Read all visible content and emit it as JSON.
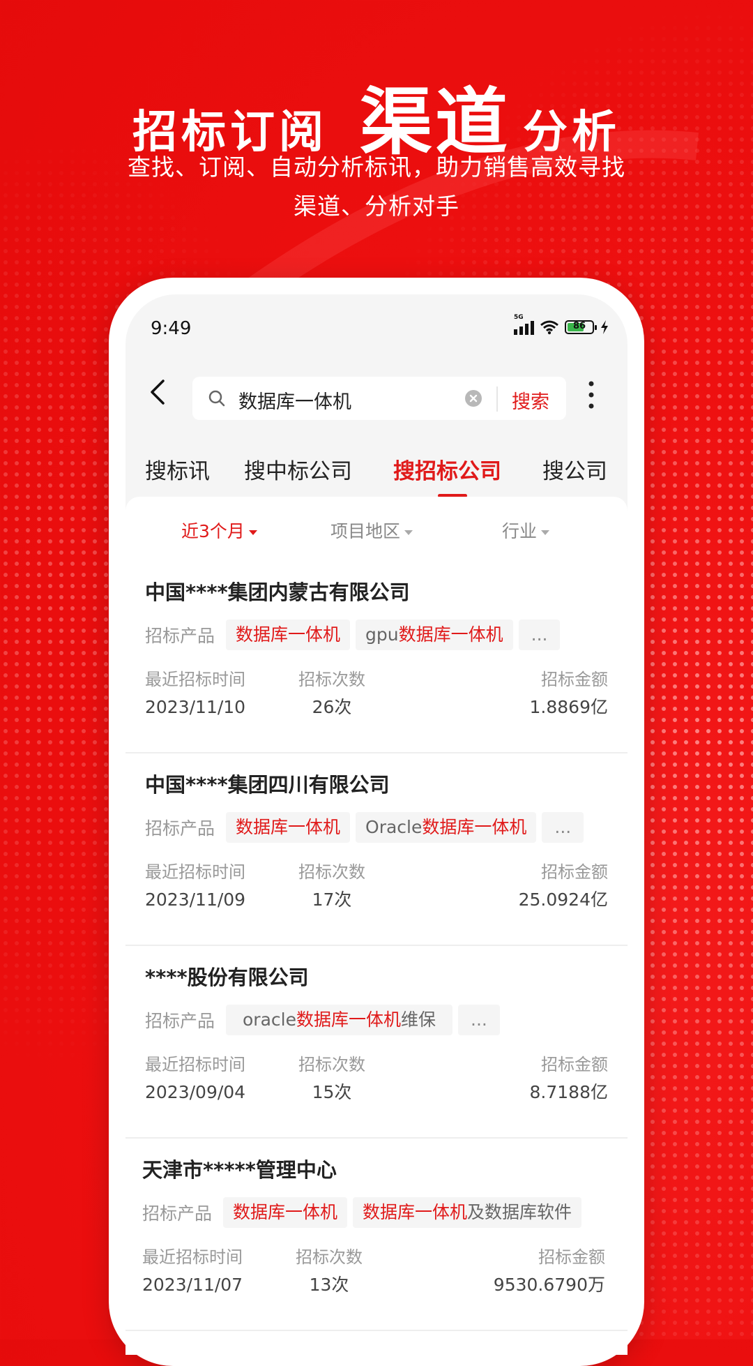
{
  "promo": {
    "title_part1": "招标订阅",
    "title_part2": "渠道",
    "title_part3": "分析",
    "subtitle_line1": "查找、订阅、自动分析标讯，助力销售高效寻找",
    "subtitle_line2": "渠道、分析对手"
  },
  "status_bar": {
    "time": "9:49",
    "network": "5G",
    "battery": "86"
  },
  "search": {
    "query": "数据库一体机",
    "button": "搜索"
  },
  "tabs": [
    {
      "label": "搜标讯",
      "active": false
    },
    {
      "label": "搜中标公司",
      "active": false
    },
    {
      "label": "搜招标公司",
      "active": true
    },
    {
      "label": "搜公司",
      "active": false
    }
  ],
  "filters": [
    {
      "label": "近3个月",
      "active": true
    },
    {
      "label": "项目地区",
      "active": false
    },
    {
      "label": "行业",
      "active": false
    }
  ],
  "labels": {
    "products": "招标产品",
    "last_time": "最近招标时间",
    "count": "招标次数",
    "amount": "招标金额"
  },
  "results": [
    {
      "company": "中国****集团内蒙古有限公司",
      "tags": [
        {
          "pre": "",
          "hl": "数据库一体机",
          "post": ""
        },
        {
          "pre": "gpu",
          "hl": "数据库一体机",
          "post": ""
        }
      ],
      "more": "...",
      "last_time": "2023/11/10",
      "count": "26次",
      "amount": "1.8869亿"
    },
    {
      "company": "中国****集团四川有限公司",
      "tags": [
        {
          "pre": "",
          "hl": "数据库一体机",
          "post": ""
        },
        {
          "pre": "Oracle",
          "hl": "数据库一体机",
          "post": ""
        }
      ],
      "more": "...",
      "last_time": "2023/11/09",
      "count": "17次",
      "amount": "25.0924亿"
    },
    {
      "company": "****股份有限公司",
      "tags": [
        {
          "pre": "oracle",
          "hl": "数据库一体机",
          "post": "维保"
        }
      ],
      "more": "...",
      "last_time": "2023/09/04",
      "count": "15次",
      "amount": "8.7188亿"
    },
    {
      "company": "天津市*****管理中心",
      "tags": [
        {
          "pre": "",
          "hl": "数据库一体机",
          "post": ""
        },
        {
          "pre": "",
          "hl": "数据库一体机",
          "post": "及数据库软件"
        }
      ],
      "more": "",
      "last_time": "2023/11/07",
      "count": "13次",
      "amount": "9530.6790万"
    }
  ],
  "colors": {
    "brand_red": "#e01a1a",
    "background_red": "#ee1010"
  }
}
